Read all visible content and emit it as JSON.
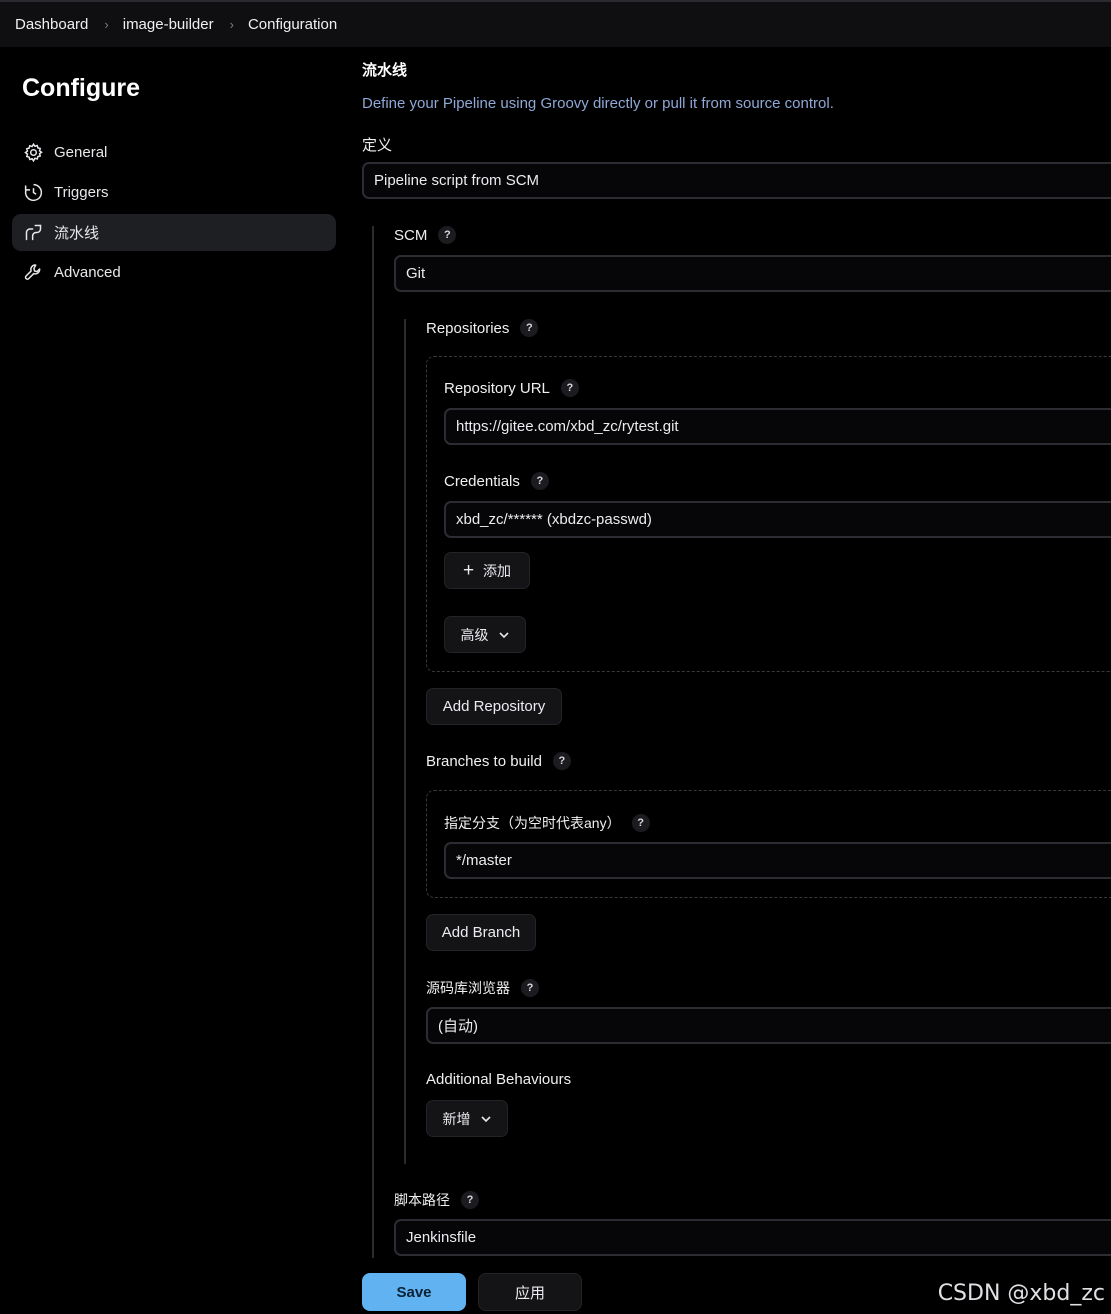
{
  "breadcrumb": {
    "items": [
      "Dashboard",
      "image-builder",
      "Configuration"
    ],
    "separator": "›"
  },
  "sidebar": {
    "title": "Configure",
    "items": [
      {
        "label": "General",
        "icon": "gear-icon"
      },
      {
        "label": "Triggers",
        "icon": "clock-icon"
      },
      {
        "label": "流水线",
        "icon": "pipeline-icon",
        "active": true
      },
      {
        "label": "Advanced",
        "icon": "wrench-icon"
      }
    ]
  },
  "pipeline": {
    "section_title": "流水线",
    "description": "Define your Pipeline using Groovy directly or pull it from source control.",
    "definition_label": "定义",
    "definition_value": "Pipeline script from SCM",
    "scm_label": "SCM",
    "scm_value": "Git",
    "repositories_label": "Repositories",
    "repo_url_label": "Repository URL",
    "repo_url_value": "https://gitee.com/xbd_zc/rytest.git",
    "credentials_label": "Credentials",
    "credentials_value": "xbd_zc/****** (xbdzc-passwd)",
    "add_label": "添加",
    "advanced_label": "高级",
    "add_repository_label": "Add Repository",
    "branches_label": "Branches to build",
    "branch_spec_label": "指定分支（为空时代表any）",
    "branch_spec_value": "*/master",
    "add_branch_label": "Add Branch",
    "repo_browser_label": "源码库浏览器",
    "repo_browser_value": "(自动)",
    "additional_behaviours_label": "Additional Behaviours",
    "add_behaviour_label": "新增",
    "script_path_label": "脚本路径",
    "script_path_value": "Jenkinsfile"
  },
  "help_glyph": "?",
  "actions": {
    "save_label": "Save",
    "apply_label": "应用"
  },
  "watermark": "CSDN @xbd_zc",
  "colors": {
    "accent": "#60b3f0",
    "background": "#000000",
    "description": "#8fa8d6"
  }
}
